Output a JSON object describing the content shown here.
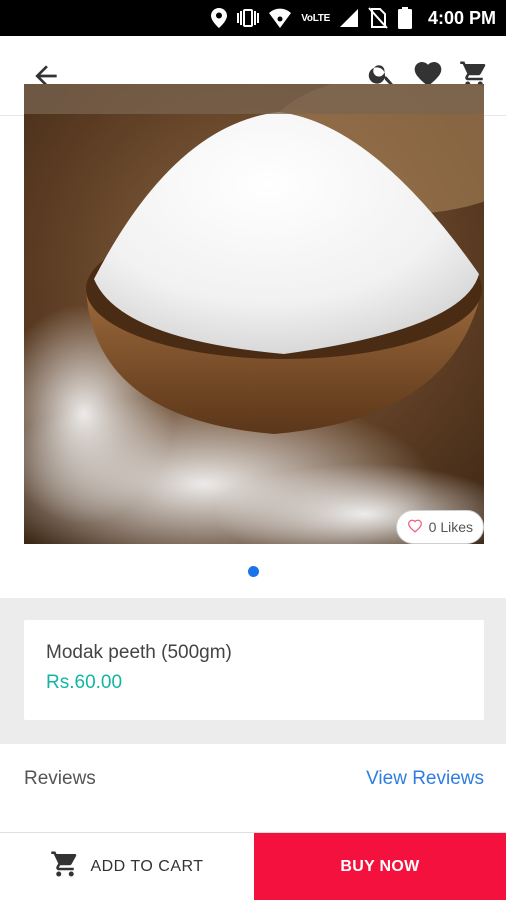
{
  "status_bar": {
    "network_label": "VoLTE",
    "time": "4:00 PM",
    "icons": [
      "location-icon",
      "vibrate-icon",
      "hotspot-icon",
      "signal-icon",
      "no-sim-icon",
      "battery-icon"
    ]
  },
  "app_bar": {
    "icons": [
      "back-arrow-icon",
      "search-icon",
      "heart-icon",
      "cart-icon"
    ]
  },
  "product_image": {
    "likes_label": "0 Likes",
    "carousel_dot_count": 1,
    "active_dot": 1
  },
  "product": {
    "name": "Modak peeth (500gm)",
    "price": "Rs.60.00"
  },
  "reviews": {
    "label": "Reviews",
    "link": "View Reviews"
  },
  "actions": {
    "add_to_cart": "ADD TO CART",
    "buy_now": "BUY NOW"
  },
  "colors": {
    "price": "#12b5a5",
    "link": "#2f7de1",
    "buy_now_bg": "#f5113e",
    "dot_active": "#1a73e8"
  }
}
